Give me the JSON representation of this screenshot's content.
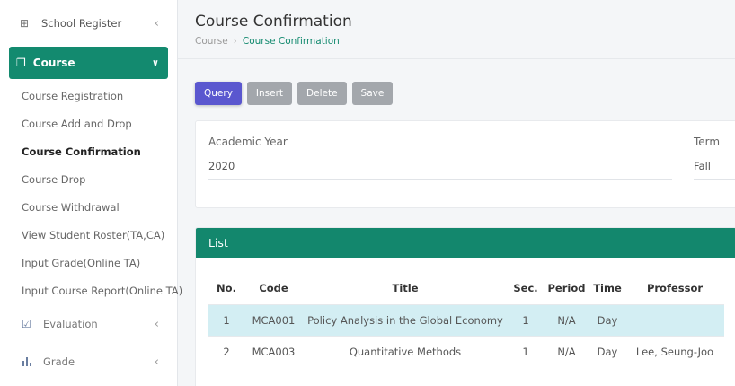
{
  "sidebar": {
    "top": {
      "label": "School Register",
      "icon": "grid-table-icon"
    },
    "active_section": {
      "label": "Course",
      "icon": "stacked-copy-icon"
    },
    "items": [
      {
        "label": "Course Registration"
      },
      {
        "label": "Course Add and Drop"
      },
      {
        "label": "Course Confirmation",
        "current": true
      },
      {
        "label": "Course Drop"
      },
      {
        "label": "Course Withdrawal"
      },
      {
        "label": "View Student Roster(TA,CA)"
      },
      {
        "label": "Input Grade(Online TA)"
      },
      {
        "label": "Input Course Report(Online TA)"
      }
    ],
    "sections": [
      {
        "label": "Evaluation",
        "icon": "check-box-icon"
      },
      {
        "label": "Grade",
        "icon": "bar-chart-icon"
      }
    ]
  },
  "header": {
    "title": "Course Confirmation",
    "breadcrumb": [
      "Course",
      "Course Confirmation"
    ]
  },
  "toolbar": {
    "query": "Query",
    "insert": "Insert",
    "delete": "Delete",
    "save": "Save"
  },
  "filters": {
    "academic_year": {
      "label": "Academic Year",
      "value": "2020"
    },
    "term": {
      "label": "Term",
      "value": "Fall"
    }
  },
  "list": {
    "title": "List",
    "columns": [
      "No.",
      "Code",
      "Title",
      "Sec.",
      "Period",
      "Time",
      "Professor"
    ],
    "rows": [
      {
        "no": "1",
        "code": "MCA001",
        "title": "Policy Analysis in the Global Economy",
        "sec": "1",
        "period": "N/A",
        "time": "Day",
        "professor": "",
        "selected": true
      },
      {
        "no": "2",
        "code": "MCA003",
        "title": "Quantitative Methods",
        "sec": "1",
        "period": "N/A",
        "time": "Day",
        "professor": "Lee, Seung-Joo"
      }
    ]
  },
  "colors": {
    "accent": "#138a6f",
    "primary_button": "#5a57cf",
    "selected_row": "#d3eef3"
  }
}
